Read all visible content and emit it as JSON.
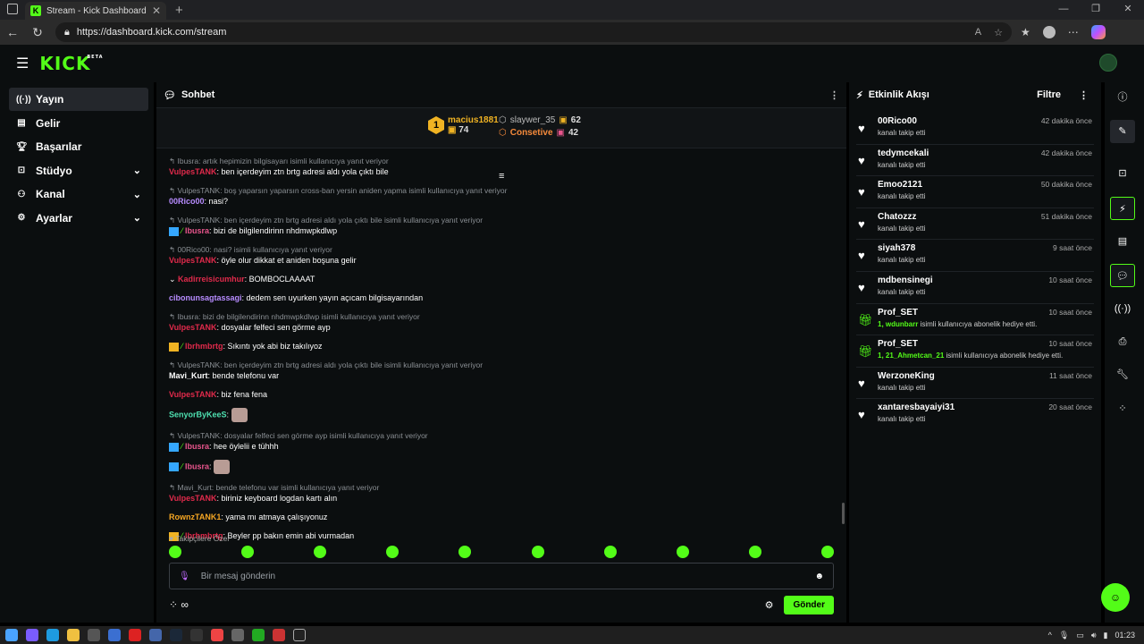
{
  "browser": {
    "tab_title": "Stream - Kick Dashboard",
    "tab_icon": "K",
    "url": "https://dashboard.kick.com/stream"
  },
  "header": {
    "logo": "KICK",
    "logo_badge": "BETA"
  },
  "sidebar": {
    "items": [
      {
        "label": "Yayın",
        "icon": "broadcast-icon"
      },
      {
        "label": "Gelir",
        "icon": "revenue-icon"
      },
      {
        "label": "Başarılar",
        "icon": "trophy-icon"
      },
      {
        "label": "Stüdyo",
        "icon": "studio-icon"
      },
      {
        "label": "Kanal",
        "icon": "channel-icon"
      },
      {
        "label": "Ayarlar",
        "icon": "gear-icon"
      }
    ]
  },
  "chat": {
    "title": "Sohbet",
    "leaderboard": {
      "rank": "1",
      "first_name": "macius1881",
      "first_count": "74",
      "second_name": "slaywer_35",
      "second_count": "62",
      "third_name": "Consetive",
      "third_count": "42"
    },
    "messages": [
      {
        "reply": "Ibusra: artık hepimizin bilgisayarı isimli kullanıcıya yanıt veriyor",
        "user": "VulpesTANK",
        "text": ": ben içerdeyim ztn brtg adresi aldı yola çıktı bile"
      },
      {
        "reply": "VulpesTANK: boş yaparsın yaparsın cross-ban yersin aniden yapma isimli kullanıcıya yanıt veriyor",
        "user": "00Rico00",
        "text": ": nasi?"
      },
      {
        "reply": "VulpesTANK: ben içerdeyim ztn brtg adresi aldı yola çıktı bile isimli kullanıcıya yanıt veriyor",
        "user": "Ibusra",
        "text": ": bizi de bilgilendirinn nhdmwpkdlwp"
      },
      {
        "reply": "00Rico00: nasi? isimli kullanıcıya yanıt veriyor",
        "user": "VulpesTANK",
        "text": ": öyle olur dikkat et aniden boşuna gelir"
      },
      {
        "reply": "",
        "user": "Kadirreisicumhur",
        "text": ": BOMBOCLAAAAT"
      },
      {
        "reply": "",
        "user": "cibonunsagtassagi",
        "text": ": dedem sen uyurken yayın açıcam bilgisayarından"
      },
      {
        "reply": "Ibusra: bizi de bilgilendirinn nhdmwpkdlwp isimli kullanıcıya yanıt veriyor",
        "user": "VulpesTANK",
        "text": ": dosyalar felfeci sen görme ayp"
      },
      {
        "reply": "",
        "user": "lbrhmbrtg",
        "text": ": Sıkıntı yok abi biz takılıyoz"
      },
      {
        "reply": "VulpesTANK: ben içerdeyim ztn brtg adresi aldı yola çıktı bile isimli kullanıcıya yanıt veriyor",
        "user": "Mavi_Kurt",
        "text": ": bende telefonu var"
      },
      {
        "reply": "",
        "user": "VulpesTANK",
        "text": ": biz fena fena"
      },
      {
        "reply": "",
        "user": "SenyorByKeeS",
        "text": ":"
      },
      {
        "reply": "VulpesTANK: dosyalar felfeci sen görme ayp isimli kullanıcıya yanıt veriyor",
        "user": "Ibusra",
        "text": ": hee öylelii e tühhh"
      },
      {
        "reply": "",
        "user": "Ibusra",
        "text": ":"
      },
      {
        "reply": "Mavi_Kurt: bende telefonu var isimli kullanıcıya yanıt veriyor",
        "user": "VulpesTANK",
        "text": ": biriniz keyboard logdan kartı alın"
      },
      {
        "reply": "",
        "user": "RownzTANK1",
        "text": ": yama mı atmaya çalışıyonuz"
      },
      {
        "reply": "",
        "user": "lbrhmbrtg",
        "text": ": Beyler pp bakın emin abi vurmadan"
      }
    ],
    "follower_note": "Takipçilere Özel",
    "input_placeholder": "Bir mesaj gönderin",
    "send_label": "Gönder"
  },
  "activity": {
    "title": "Etkinlik Akışı",
    "filter_label": "Filtre",
    "items": [
      {
        "name": "00Rico00",
        "time": "42 dakika önce",
        "desc": "kanalı takip etti",
        "type": "follow"
      },
      {
        "name": "tedymcekali",
        "time": "42 dakika önce",
        "desc": "kanalı takip etti",
        "type": "follow"
      },
      {
        "name": "Emoo2121",
        "time": "50 dakika önce",
        "desc": "kanalı takip etti",
        "type": "follow"
      },
      {
        "name": "Chatozzz",
        "time": "51 dakika önce",
        "desc": "kanalı takip etti",
        "type": "follow"
      },
      {
        "name": "siyah378",
        "time": "9 saat önce",
        "desc": "kanalı takip etti",
        "type": "follow"
      },
      {
        "name": "mdbensinegi",
        "time": "10 saat önce",
        "desc": "kanalı takip etti",
        "type": "follow"
      },
      {
        "name": "Prof_SET",
        "time": "10 saat önce",
        "desc_highlight": "1, wdunbarr",
        "desc": " isimli kullanıcıya abonelik hediye etti.",
        "type": "gift"
      },
      {
        "name": "Prof_SET",
        "time": "10 saat önce",
        "desc_highlight": "1, 21_Ahmetcan_21",
        "desc": " isimli kullanıcıya abonelik hediye etti.",
        "type": "gift"
      },
      {
        "name": "WerzoneKing",
        "time": "11 saat önce",
        "desc": "kanalı takip etti",
        "type": "follow"
      },
      {
        "name": "xantaresbayaiyi31",
        "time": "20 saat önce",
        "desc": "kanalı takip etti",
        "type": "follow"
      }
    ]
  },
  "taskbar": {
    "time": "01:23"
  },
  "colors": {
    "accent": "#53fc18",
    "bg": "#0b0e0f",
    "panel": "#111416"
  }
}
